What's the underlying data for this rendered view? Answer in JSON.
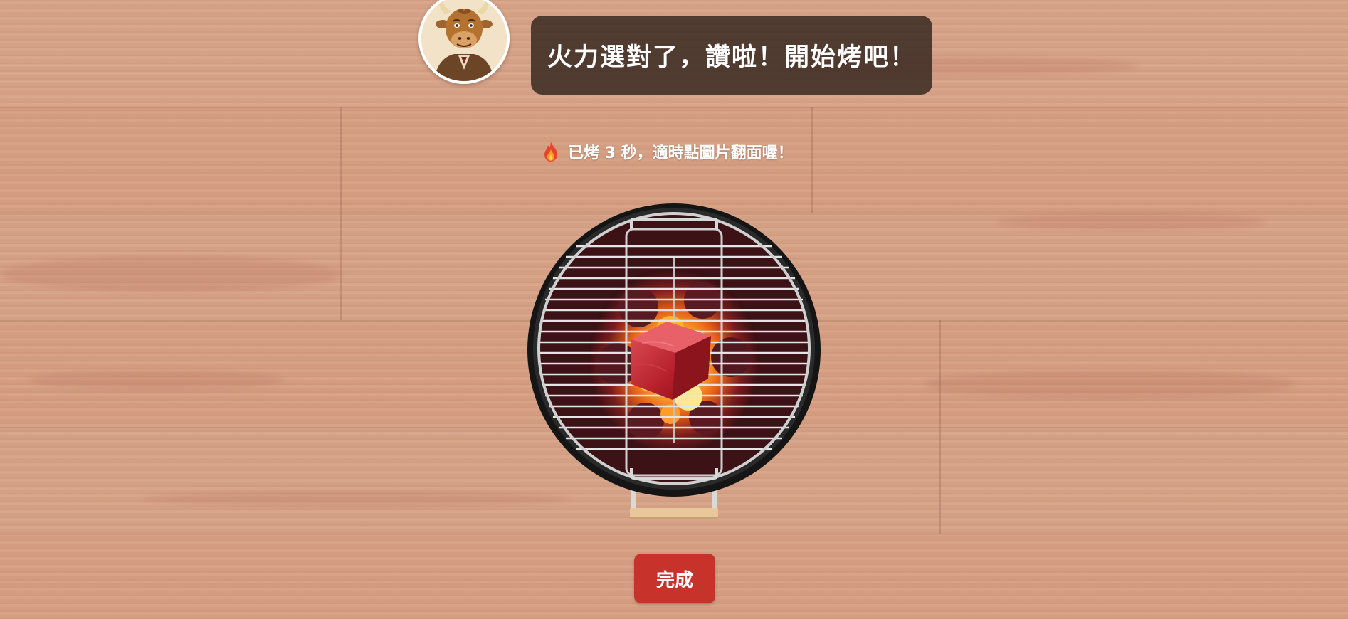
{
  "dialog": {
    "message": "火力選對了，讚啦！開始烤吧！",
    "speaker_avatar": "bull-chef-avatar"
  },
  "status": {
    "icon": "fire-icon",
    "text": "已烤 3 秒，適時點圖片翻面喔！"
  },
  "grill": {
    "icon": "charcoal-grill",
    "food": "raw-beef-cube"
  },
  "actions": {
    "done_label": "完成"
  },
  "colors": {
    "button": "#c7332b",
    "bubble": "#3a2a22",
    "table_wood": "#d49d80"
  }
}
